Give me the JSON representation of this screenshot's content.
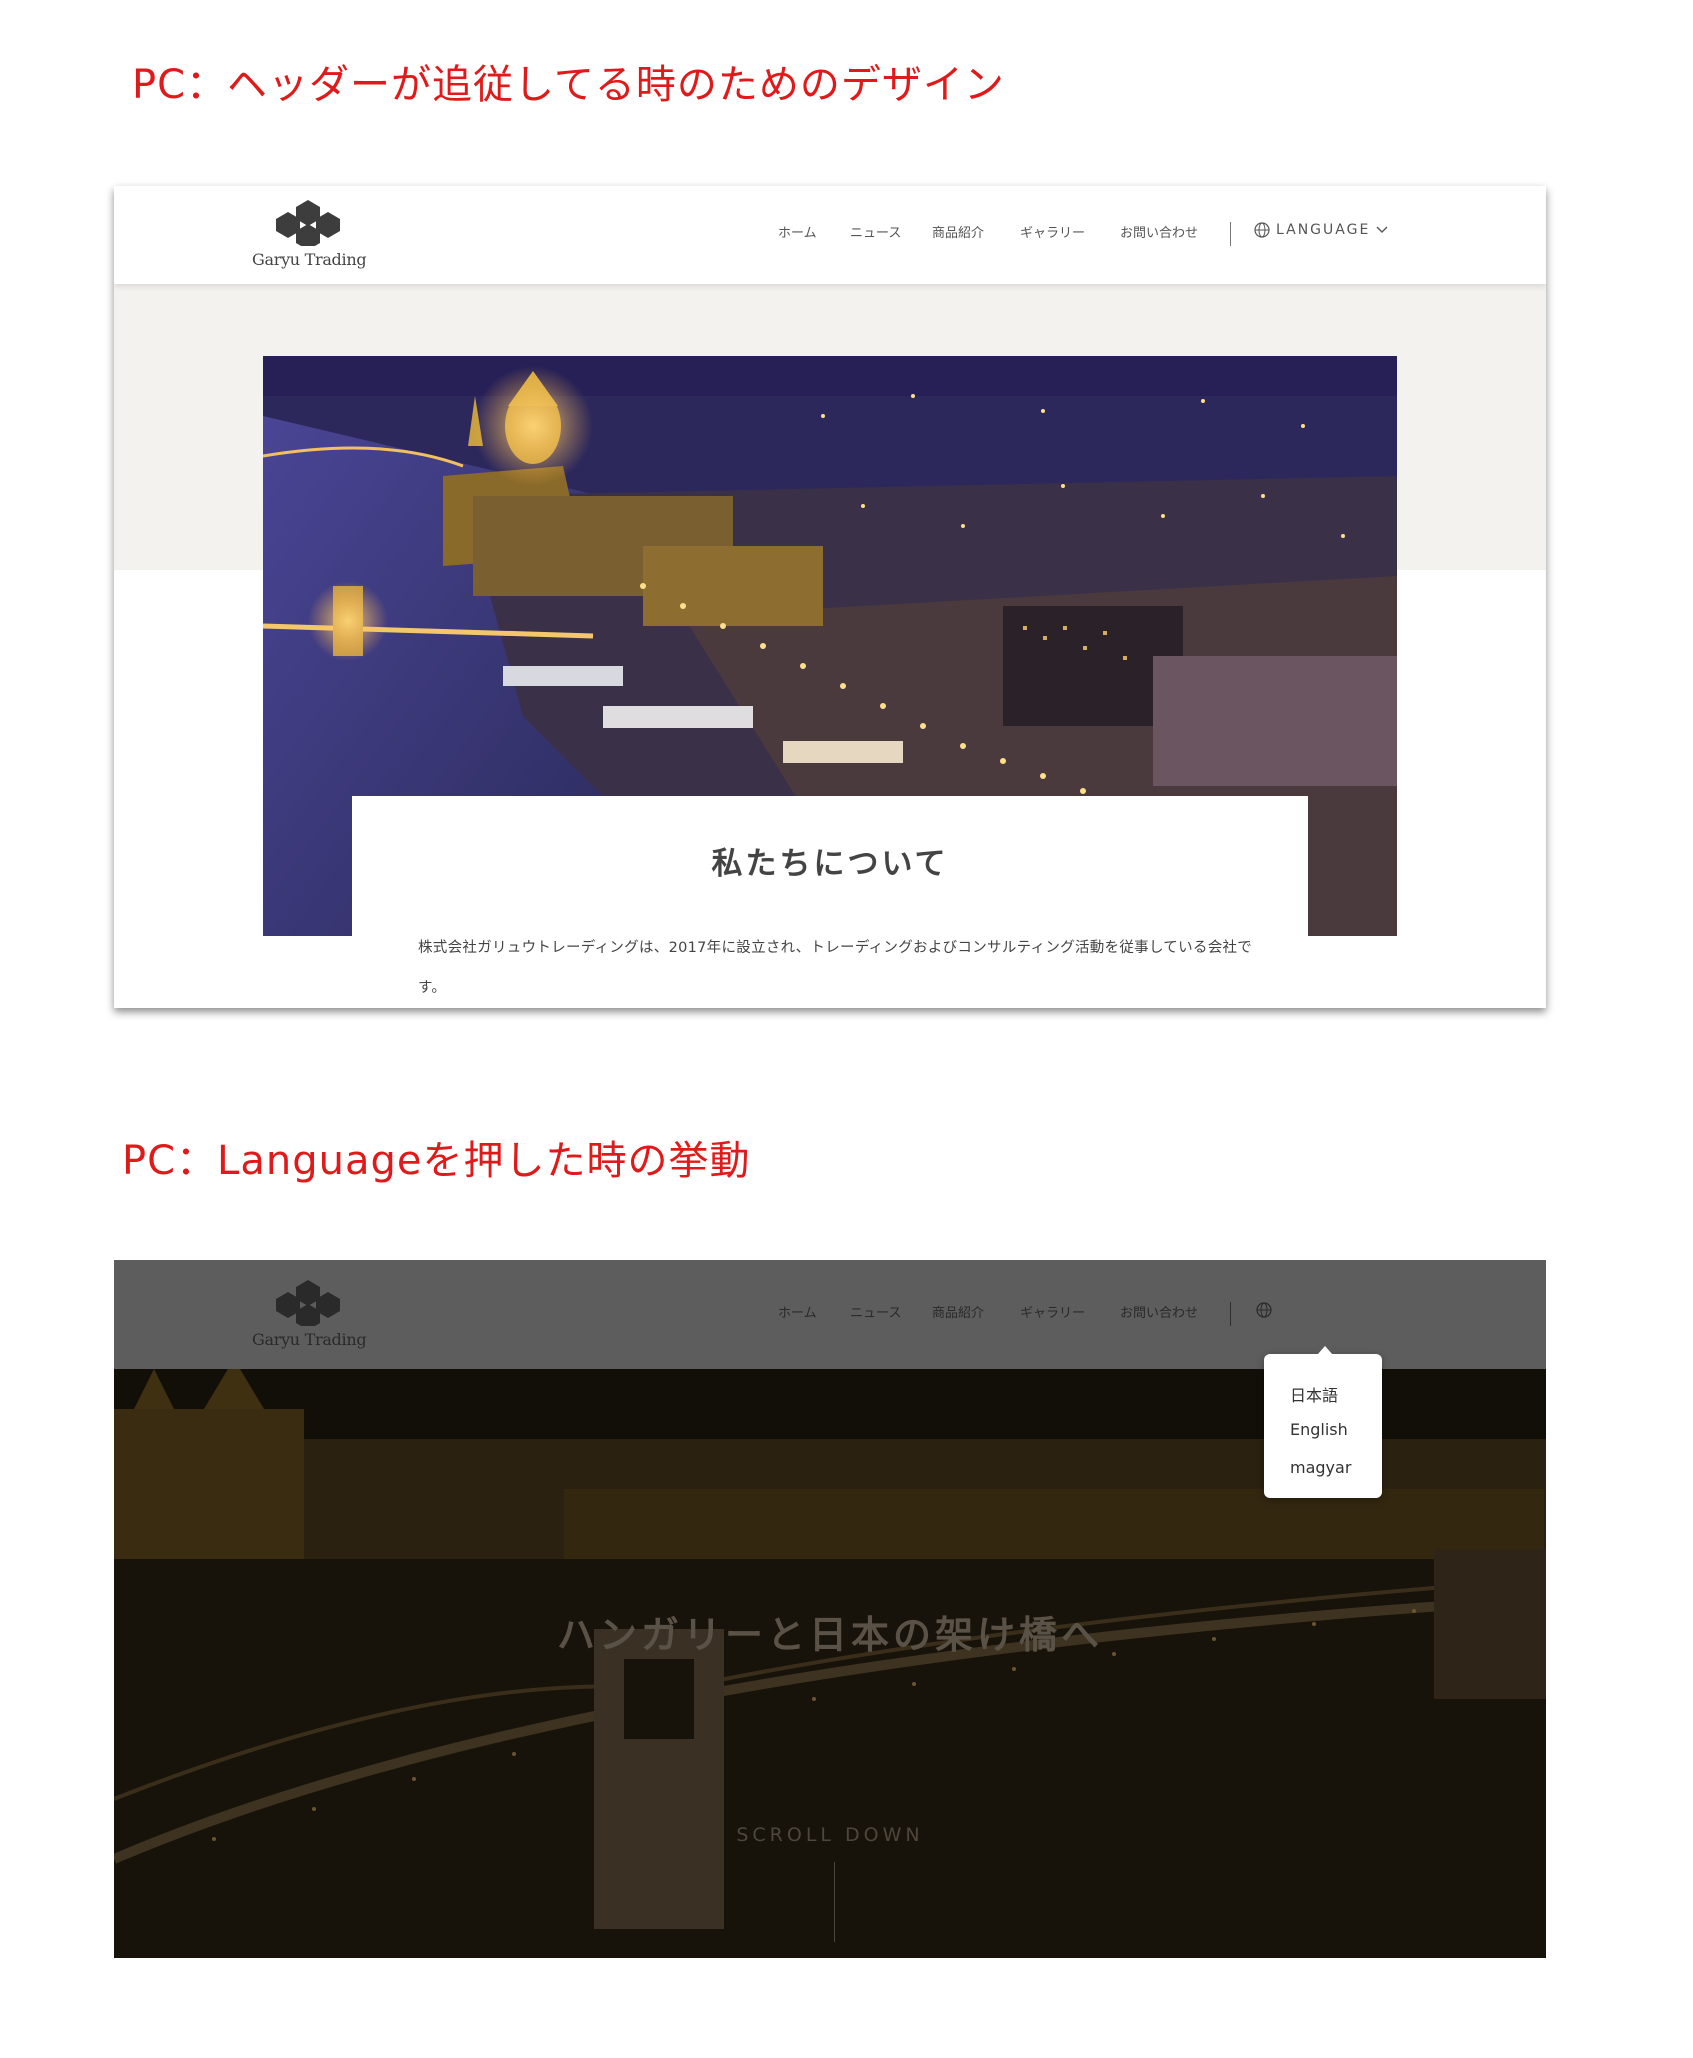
{
  "captions": {
    "sticky_header": "PC：ヘッダーが追従してる時のためのデザイン",
    "language_click": "PC：Languageを押した時の挙動"
  },
  "site": {
    "logo_text": "Garyu Trading",
    "nav": [
      "ホーム",
      "ニュース",
      "商品紹介",
      "ギャラリー",
      "お問い合わせ"
    ],
    "language_label": "LANGUAGE"
  },
  "about": {
    "title": "私たちについて",
    "body": "株式会社ガリュウトレーディングは、2017年に設立され、トレーディングおよびコンサルティング活動を従事している会社です。"
  },
  "language_menu": {
    "options": [
      "日本語",
      "English",
      "magyar"
    ]
  },
  "hero": {
    "title": "ハンガリーと日本の架け橋へ",
    "scroll_label": "SCROLL DOWN"
  },
  "colors": {
    "caption": "#e01a1a",
    "header_bg": "#ffffff",
    "beige_band": "#f4f2ef",
    "dim_header": "#5d5d5d"
  }
}
